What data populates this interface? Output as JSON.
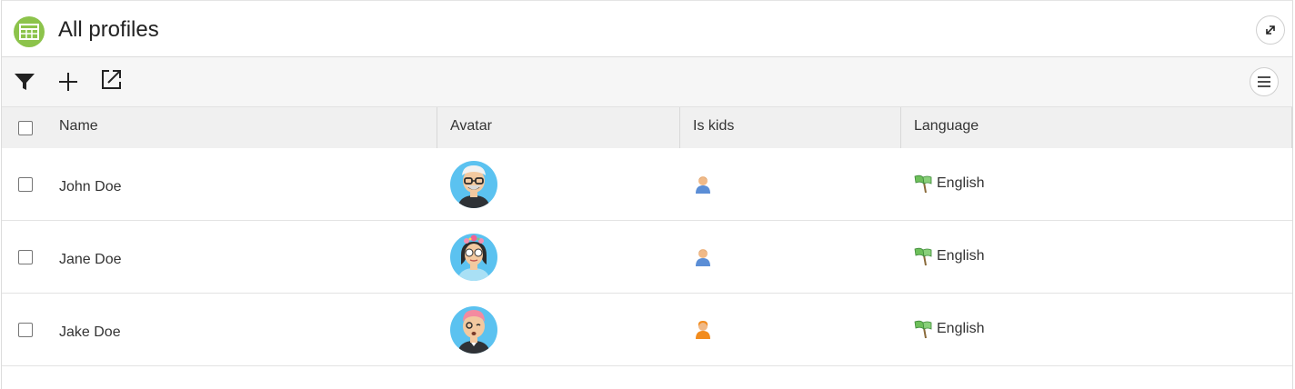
{
  "header": {
    "title": "All profiles"
  },
  "table": {
    "columns": [
      "Name",
      "Avatar",
      "Is kids",
      "Language"
    ],
    "rows": [
      {
        "name": "John Doe",
        "avatar": "avatar-man-glasses",
        "is_kids": "adult-icon",
        "language": "English"
      },
      {
        "name": "Jane Doe",
        "avatar": "avatar-woman-flowers",
        "is_kids": "adult-icon",
        "language": "English"
      },
      {
        "name": "Jake Doe",
        "avatar": "avatar-boy-pink-hair",
        "is_kids": "kid-icon",
        "language": "English"
      }
    ]
  },
  "icons": {
    "app": "table-grid-icon",
    "expand": "expand-arrow-icon",
    "filter": "filter-icon",
    "add": "plus-icon",
    "export": "export-icon",
    "menu": "hamburger-menu-icon",
    "language": "flag-icon"
  },
  "colors": {
    "app_icon_bg": "#8cc34b",
    "avatar_bg": "#5bc2f0",
    "kid_icon": "#f28c1e",
    "adult_icon": "#5b8ed6"
  }
}
